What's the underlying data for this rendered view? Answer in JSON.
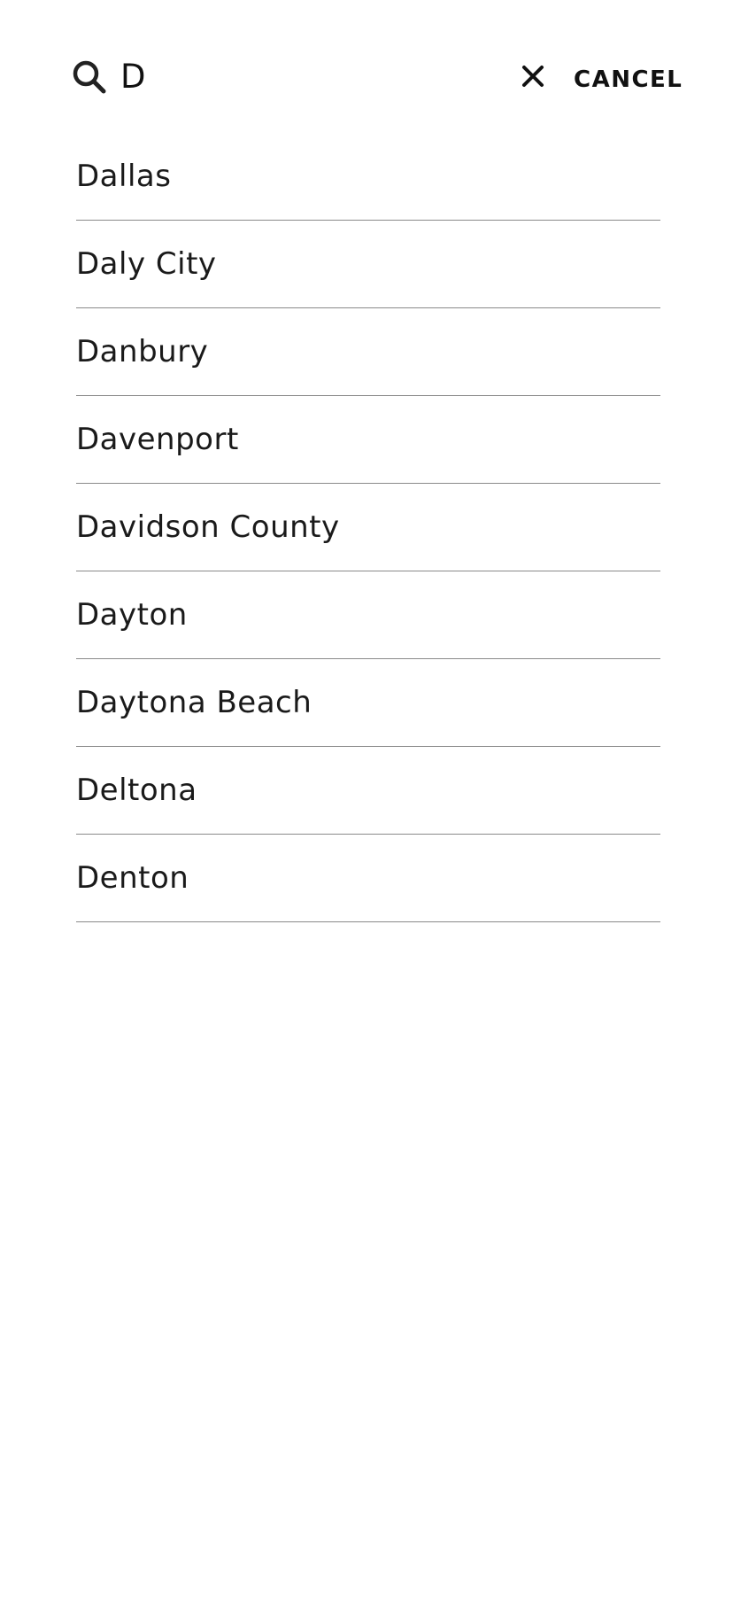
{
  "search": {
    "icon": "search-icon",
    "value": "D",
    "clear_icon": "close-icon",
    "cancel_label": "CANCEL"
  },
  "results": [
    {
      "label": "Dallas"
    },
    {
      "label": "Daly City"
    },
    {
      "label": "Danbury"
    },
    {
      "label": "Davenport"
    },
    {
      "label": "Davidson County"
    },
    {
      "label": "Dayton"
    },
    {
      "label": "Daytona Beach"
    },
    {
      "label": "Deltona"
    },
    {
      "label": "Denton"
    }
  ],
  "colors": {
    "text": "#111111",
    "divider": "#8a8a8a",
    "background": "#ffffff"
  }
}
